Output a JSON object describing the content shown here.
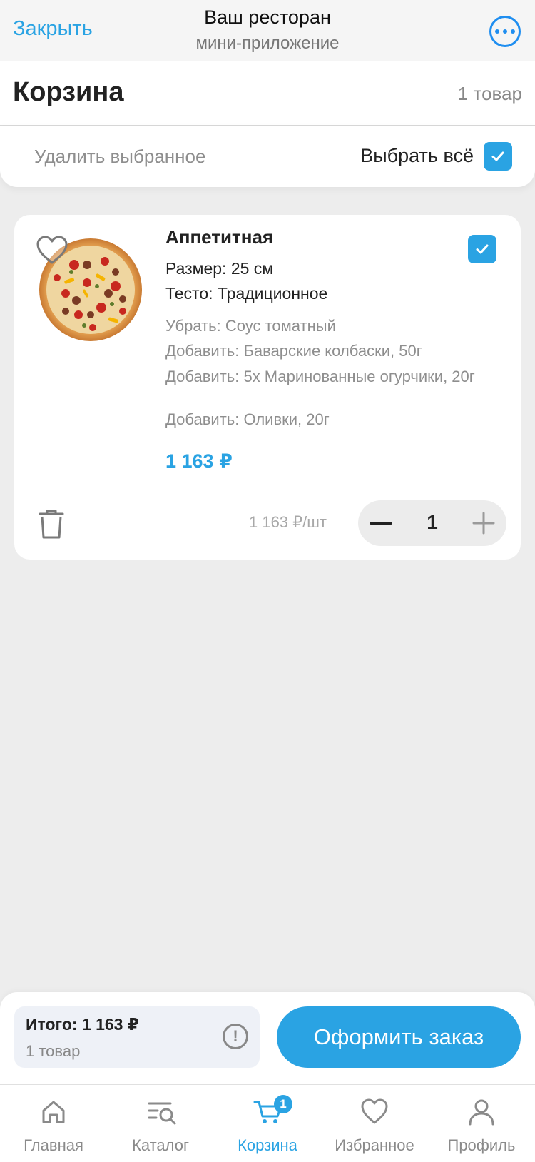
{
  "topbar": {
    "close_label": "Закрыть",
    "title": "Ваш ресторан",
    "subtitle": "мини-приложение",
    "more_icon": "more-dots-icon"
  },
  "cart": {
    "title": "Корзина",
    "count": "1 товар",
    "delete_selected": "Удалить выбранное",
    "select_all": "Выбрать всё",
    "select_all_checked": true
  },
  "item": {
    "name": "Аппетитная",
    "checked": true,
    "favorite": false,
    "size": "Размер: 25 см",
    "dough": "Тесто: Традиционное",
    "modifiers": [
      "Убрать: Соус томатный",
      "Добавить: Баварские колбаски, 50г",
      "Добавить: 5х Маринованные огурчики, 20г",
      "Добавить: Оливки, 20г"
    ],
    "price": "1 163 ₽",
    "unit_price": "1 163 ₽/шт",
    "quantity": "1"
  },
  "checkout": {
    "total": "Итого: 1 163 ₽",
    "total_sub": "1 товар",
    "info_glyph": "!",
    "order_button": "Оформить заказ"
  },
  "tabs": [
    {
      "label": "Главная",
      "icon": "home-icon",
      "active": false
    },
    {
      "label": "Каталог",
      "icon": "catalog-search-icon",
      "active": false
    },
    {
      "label": "Корзина",
      "icon": "cart-icon",
      "active": true,
      "badge": "1"
    },
    {
      "label": "Избранное",
      "icon": "heart-icon",
      "active": false
    },
    {
      "label": "Профиль",
      "icon": "profile-icon",
      "active": false
    }
  ],
  "colors": {
    "accent": "#2aa3e3",
    "link": "#1f8ef0",
    "background": "#ededed"
  }
}
